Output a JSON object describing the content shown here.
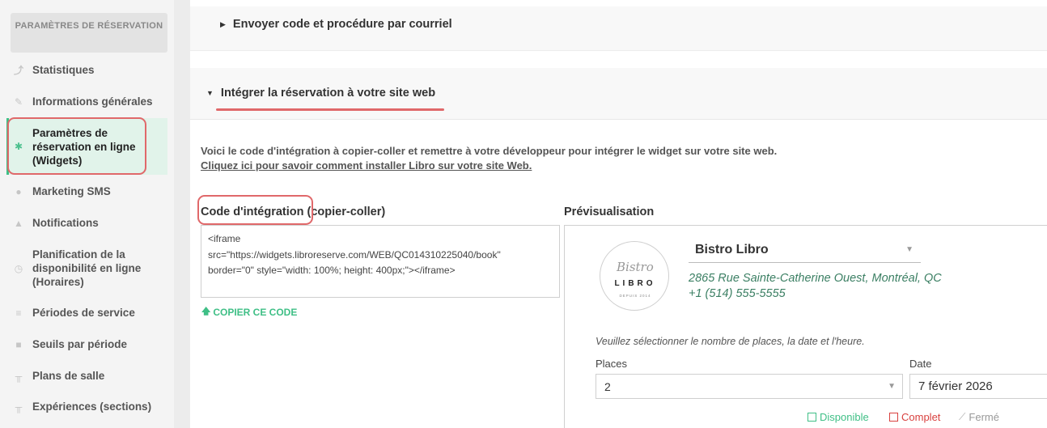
{
  "sidebar": {
    "header": "PARAMÈTRES DE RÉSERVATION",
    "items": [
      {
        "label": "Statistiques",
        "icon": "chart-line-icon"
      },
      {
        "label": "Informations générales",
        "icon": "edit-icon"
      },
      {
        "label": "Paramètres de réservation en ligne (Widgets)",
        "icon": "gear-icon",
        "active": true
      },
      {
        "label": "Marketing SMS",
        "icon": "chat-bubble-icon"
      },
      {
        "label": "Notifications",
        "icon": "bell-icon"
      },
      {
        "label": "Planification de la disponibilité en ligne (Horaires)",
        "icon": "clock-icon"
      },
      {
        "label": "Périodes de service",
        "icon": "list-icon"
      },
      {
        "label": "Seuils par période",
        "icon": "lock-icon"
      },
      {
        "label": "Plans de salle",
        "icon": "table-icon"
      },
      {
        "label": "Expériences (sections)",
        "icon": "table-icon"
      }
    ]
  },
  "panels": {
    "email": {
      "title": "Envoyer code et procédure par courriel"
    },
    "integrate": {
      "title": "Intégrer la réservation à votre site web"
    }
  },
  "intro": {
    "text": "Voici le code d'intégration à copier-coller et remettre à votre développeur pour intégrer le widget sur votre site web.",
    "link": "Cliquez ici pour savoir comment installer Libro sur votre site Web."
  },
  "code": {
    "label": "Code d'intégration (copier-coller)",
    "value": "<iframe\nsrc=\"https://widgets.libroreserve.com/WEB/QC014310225040/book\"\nborder=\"0\" style=\"width: 100%; height: 400px;\"></iframe>",
    "copy_label": "COPIER CE CODE"
  },
  "preview": {
    "label": "Prévisualisation",
    "logo": {
      "script": "Bistro",
      "word": "LIBRO",
      "since": "DEPUIS 2014"
    },
    "restaurant": "Bistro Libro",
    "address": "2865 Rue Sainte-Catherine Ouest, Montréal, QC",
    "phone": "+1 (514) 555-5555",
    "instructions": "Veuillez sélectionner le nombre de places, la date et l'heure.",
    "places_label": "Places",
    "places_value": "2",
    "date_label": "Date",
    "date_value": "7 février 2026",
    "legend": {
      "available": "Disponible",
      "full": "Complet",
      "closed": "Fermé"
    }
  },
  "colors": {
    "accent": "#3fbf86",
    "highlight": "#e0686a",
    "full": "#d9413f"
  }
}
